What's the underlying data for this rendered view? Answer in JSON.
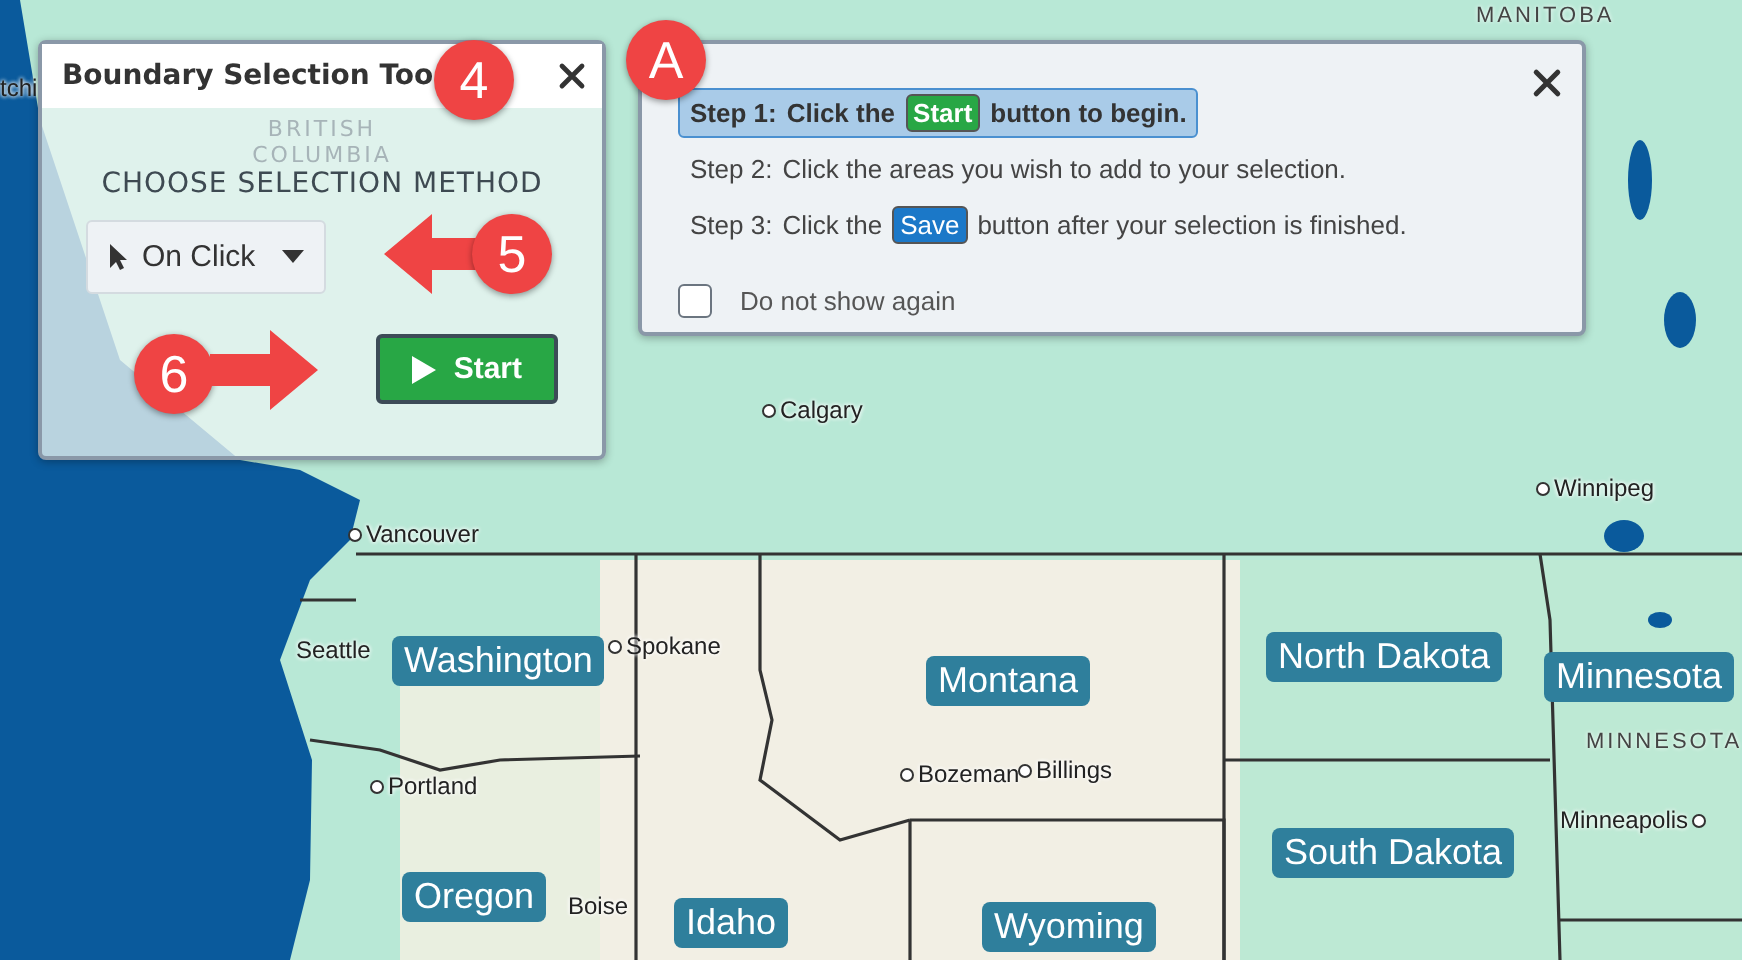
{
  "map": {
    "region_labels": [
      {
        "text": "MANITOBA"
      },
      {
        "text": "MINNESOTA"
      }
    ],
    "cities": [
      {
        "name": "tchi"
      },
      {
        "name": "Calgary"
      },
      {
        "name": "Vancouver"
      },
      {
        "name": "Seattle"
      },
      {
        "name": "Spokane"
      },
      {
        "name": "Portland"
      },
      {
        "name": "Boise"
      },
      {
        "name": "Bozeman"
      },
      {
        "name": "Billings"
      },
      {
        "name": "Winnipeg"
      },
      {
        "name": "Minneapolis"
      }
    ],
    "states": [
      "Washington",
      "Montana",
      "North Dakota",
      "Minnesota",
      "Oregon",
      "Idaho",
      "South Dakota",
      "Wyoming"
    ]
  },
  "tool_panel": {
    "title": "Boundary Selection Too",
    "background_label": "BRITISH COLUMBIA",
    "heading": "CHOOSE SELECTION METHOD",
    "method": "On Click",
    "start_button": "Start"
  },
  "instructions": {
    "steps": [
      {
        "label": "Step 1:",
        "text_before": "Click the",
        "badge": {
          "text": "Start",
          "kind": "start"
        },
        "text_after": "button to begin.",
        "selected": true
      },
      {
        "label": "Step 2:",
        "text_before": "Click the areas you wish to add to your selection.",
        "selected": false
      },
      {
        "label": "Step 3:",
        "text_before": "Click the",
        "badge": {
          "text": "Save",
          "kind": "save"
        },
        "text_after": "button after your selection is finished.",
        "selected": false
      }
    ],
    "checkbox": {
      "label": "Do not show again",
      "checked": false
    }
  },
  "callouts": [
    {
      "label": "4",
      "kind": "plain"
    },
    {
      "label": "A",
      "kind": "plain"
    },
    {
      "label": "5",
      "kind": "arrow-left"
    },
    {
      "label": "6",
      "kind": "arrow-right"
    }
  ]
}
